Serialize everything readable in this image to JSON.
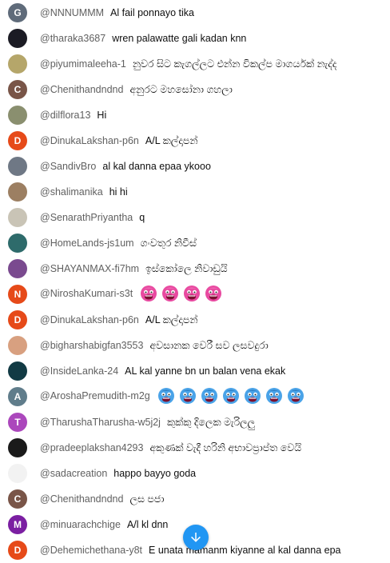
{
  "messages": [
    {
      "author": "@NNNUMMM",
      "text": "Al fail ponnayo tika",
      "initial": "G",
      "avatar_color": "#5f6b7a",
      "avatar_kind": "letter"
    },
    {
      "author": "@tharaka3687",
      "text": "wren palawatte gali kadan knn",
      "initial": "",
      "avatar_color": "#1b1b24",
      "avatar_kind": "photo"
    },
    {
      "author": "@piyumimaleeha-1",
      "text": "නුවර සිට කැගල්ලට එන්න විකල්ප මාගර්යක් නැද්ද",
      "initial": "",
      "avatar_color": "#b5a66a",
      "avatar_kind": "photo"
    },
    {
      "author": "@Chenithandndnd",
      "text": "අනුරට මහසෝනා ගහලා",
      "initial": "C",
      "avatar_color": "#795548",
      "avatar_kind": "letter"
    },
    {
      "author": "@dilflora13",
      "text": "Hi",
      "initial": "",
      "avatar_color": "#8a8f6f",
      "avatar_kind": "photo"
    },
    {
      "author": "@DinukaLakshan-p6n",
      "text": "A/L කල්දාපන්",
      "initial": "D",
      "avatar_color": "#e64a19",
      "avatar_kind": "letter"
    },
    {
      "author": "@SandivBro",
      "text": "al kal danna epaa ykooo",
      "initial": "",
      "avatar_color": "#6f7885",
      "avatar_kind": "photo"
    },
    {
      "author": "@shalimanika",
      "text": "hi hi",
      "initial": "",
      "avatar_color": "#9c7f62",
      "avatar_kind": "photo"
    },
    {
      "author": "@SenarathPriyantha",
      "text": "q",
      "initial": "",
      "avatar_color": "#c9c4b6",
      "avatar_kind": "photo"
    },
    {
      "author": "@HomeLands-js1um",
      "text": "ගංවතුර නිවීස්",
      "initial": "",
      "avatar_color": "#2e6b6b",
      "avatar_kind": "photo"
    },
    {
      "author": "@SHAYANMAX-fi7hm",
      "text": "ඉස්කෝලෙ නිවාඩුයි",
      "initial": "",
      "avatar_color": "#7a4a8f",
      "avatar_kind": "photo"
    },
    {
      "author": "@NiroshaKumari-s3t",
      "text": "",
      "initial": "N",
      "avatar_color": "#e64a19",
      "avatar_kind": "letter",
      "emojis": [
        "pink-face-emoji",
        "pink-face-emoji",
        "pink-face-emoji",
        "pink-face-emoji"
      ]
    },
    {
      "author": "@DinukaLakshan-p6n",
      "text": "A/L කල්දාපන්",
      "initial": "D",
      "avatar_color": "#e64a19",
      "avatar_kind": "letter"
    },
    {
      "author": "@bigharshabigfan3553",
      "text": "අවසානක වෙරී සව ලසවදුරා",
      "initial": "",
      "avatar_color": "#d8a080",
      "avatar_kind": "photo"
    },
    {
      "author": "@InsideLanka-24",
      "text": "AL kal yanne bn un balan vena ekak",
      "initial": "",
      "avatar_color": "#123a44",
      "avatar_kind": "photo"
    },
    {
      "author": "@AroshaPremudith-m2g",
      "text": "",
      "initial": "A",
      "avatar_color": "#607d8b",
      "avatar_kind": "letter",
      "emojis": [
        "blue-face-emoji",
        "blue-face-emoji",
        "blue-face-emoji",
        "blue-face-emoji",
        "blue-face-emoji",
        "blue-face-emoji",
        "blue-face-emoji"
      ]
    },
    {
      "author": "@TharushaTharusha-w5j2j",
      "text": "කුක්කු දිලෙක මැරිලලු",
      "initial": "T",
      "avatar_color": "#ab47bc",
      "avatar_kind": "letter"
    },
    {
      "author": "@pradeeplakshan4293",
      "text": "අකුණක් වැදී හරිනි අභාවප්‍රාප්ත වෙයි",
      "initial": "",
      "avatar_color": "#1a1a1a",
      "avatar_kind": "photo"
    },
    {
      "author": "@sadacreation",
      "text": "happo bayyo goda",
      "initial": "",
      "avatar_color": "#f2f2f2",
      "avatar_kind": "photo"
    },
    {
      "author": "@Chenithandndnd",
      "text": "ලස පජා",
      "initial": "C",
      "avatar_color": "#795548",
      "avatar_kind": "letter"
    },
    {
      "author": "@minuarachchige",
      "text": "A/l kl dnn",
      "initial": "M",
      "avatar_color": "#7b1fa2",
      "avatar_kind": "letter"
    },
    {
      "author": "@Dehemichethana-y8t",
      "text": "E unata mamanm kiyanne al kal danna epa",
      "initial": "D",
      "avatar_color": "#e64a19",
      "avatar_kind": "letter"
    }
  ],
  "scroll_button": {
    "icon": "arrow-down-icon",
    "color": "#2196f3"
  }
}
